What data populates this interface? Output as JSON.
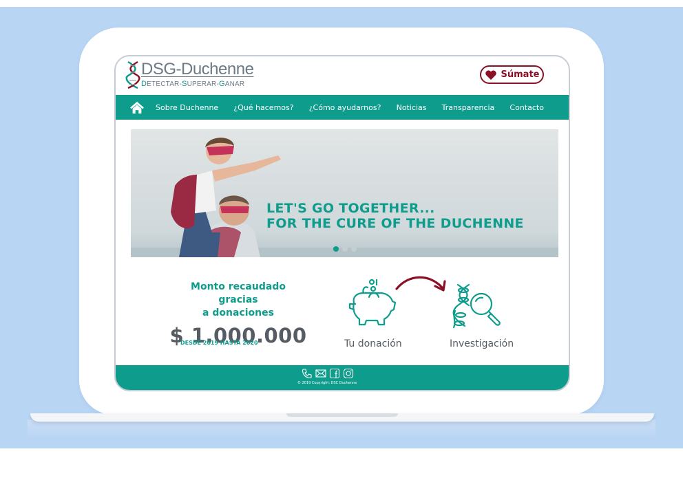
{
  "brand": {
    "name": "DSG-Duchenne",
    "tagline": [
      {
        "cap": "D",
        "rest": "ETECTAR"
      },
      {
        "sep": "-"
      },
      {
        "cap": "S",
        "rest": "UPERAR"
      },
      {
        "sep": "-"
      },
      {
        "cap": "G",
        "rest": "ANAR"
      }
    ]
  },
  "header": {
    "join_label": "Súmate"
  },
  "nav": {
    "items": [
      "Sobre Duchenne",
      "¿Qué hacemos?",
      "¿Cómo ayudarnos?",
      "Noticias",
      "Transparencia",
      "Contacto"
    ]
  },
  "hero": {
    "line1": "LET'S GO TOGETHER...",
    "line2": "FOR THE CURE OF THE DUCHENNE",
    "slides": 3,
    "active_slide": 1
  },
  "stats": {
    "title_line1": "Monto recaudado gracias",
    "title_line2": "a donaciones",
    "amount": "$ 1.000.000",
    "since": "DESDE 2019 HASTA 2020"
  },
  "flow": {
    "donation_label": "Tu donación",
    "research_label": "Investigación"
  },
  "footer": {
    "icons": [
      "phone-icon",
      "mail-icon",
      "facebook-icon",
      "instagram-icon"
    ],
    "copyright": "© 2019 Copyright: DSC Duchenne"
  },
  "colors": {
    "teal": "#0e9d8c",
    "maroon": "#8a1026",
    "backdrop": "#b9d5f4"
  }
}
